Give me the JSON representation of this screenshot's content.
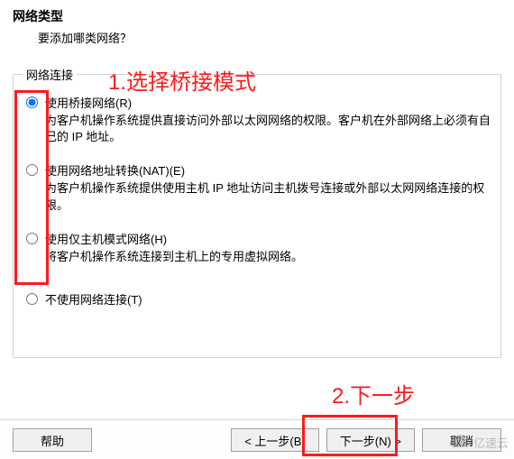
{
  "header": {
    "title": "网络类型",
    "subtitle": "要添加哪类网络？"
  },
  "group": {
    "legend": "网络连接"
  },
  "options": [
    {
      "label": "使用桥接网络(R)",
      "desc": "为客户机操作系统提供直接访问外部以太网网络的权限。客户机在外部网络上必须有自己的 IP 地址。",
      "selected": true
    },
    {
      "label": "使用网络地址转换(NAT)(E)",
      "desc": "为客户机操作系统提供使用主机 IP 地址访问主机拨号连接或外部以太网网络连接的权限。",
      "selected": false
    },
    {
      "label": "使用仅主机模式网络(H)",
      "desc": "将客户机操作系统连接到主机上的专用虚拟网络。",
      "selected": false
    },
    {
      "label": "不使用网络连接(T)",
      "desc": "",
      "selected": false
    }
  ],
  "footer": {
    "help": "帮助",
    "back": "< 上一步(B)",
    "next": "下一步(N) >",
    "cancel": "取消"
  },
  "annotations": {
    "step1": "1.选择桥接模式",
    "step2": "2.下一步"
  },
  "watermark": {
    "text": "亿速云"
  }
}
